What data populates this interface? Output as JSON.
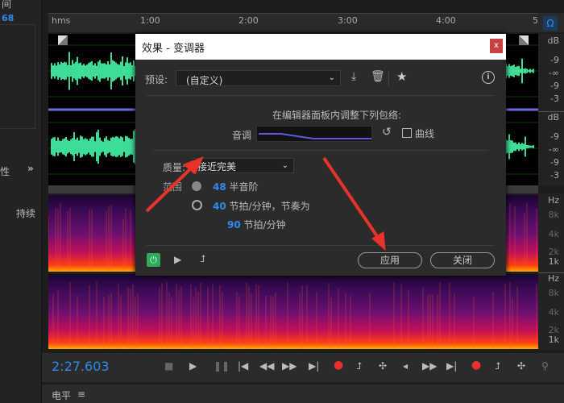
{
  "left_panel": {
    "top_label": "间",
    "value": "68",
    "tab_label": "性",
    "expand": "»",
    "duration_label": "持续"
  },
  "ruler": {
    "unit": "hms",
    "ticks": [
      "1:00",
      "2:00",
      "3:00",
      "4:00",
      "5"
    ]
  },
  "db_scale": {
    "unit": "dB",
    "labels": [
      "-9",
      "-∞",
      "-9",
      "-3"
    ]
  },
  "hz_scale": {
    "unit": "Hz",
    "labels": [
      "8k",
      "4k",
      "2k",
      "1k"
    ]
  },
  "transport": {
    "time": "2:27.603"
  },
  "bottom_panel": {
    "title": "电平",
    "menu": "≡"
  },
  "dialog": {
    "title": "效果 - 变调器",
    "close": "x",
    "preset_label": "预设:",
    "preset_value": "(自定义)",
    "envelope_hint": "在编辑器面板内调整下列包络:",
    "pitch_label": "音调",
    "curve_label": "曲线",
    "curve_checked": false,
    "quality_label": "质量:",
    "quality_value": "接近完美",
    "range_label": "范围",
    "range_options": [
      {
        "value": "48",
        "label": "半音阶",
        "selected": true
      },
      {
        "value": "40",
        "label": "节拍/分钟，节奏为",
        "selected": false
      }
    ],
    "tempo_value": "90",
    "tempo_label": "节拍/分钟",
    "apply": "应用",
    "cancel": "关闭"
  },
  "colors": {
    "accent": "#2d8ceb",
    "waveform": "#3ddc97",
    "record": "#e83030",
    "power": "#2faa5a",
    "arrow": "#e8322a"
  }
}
